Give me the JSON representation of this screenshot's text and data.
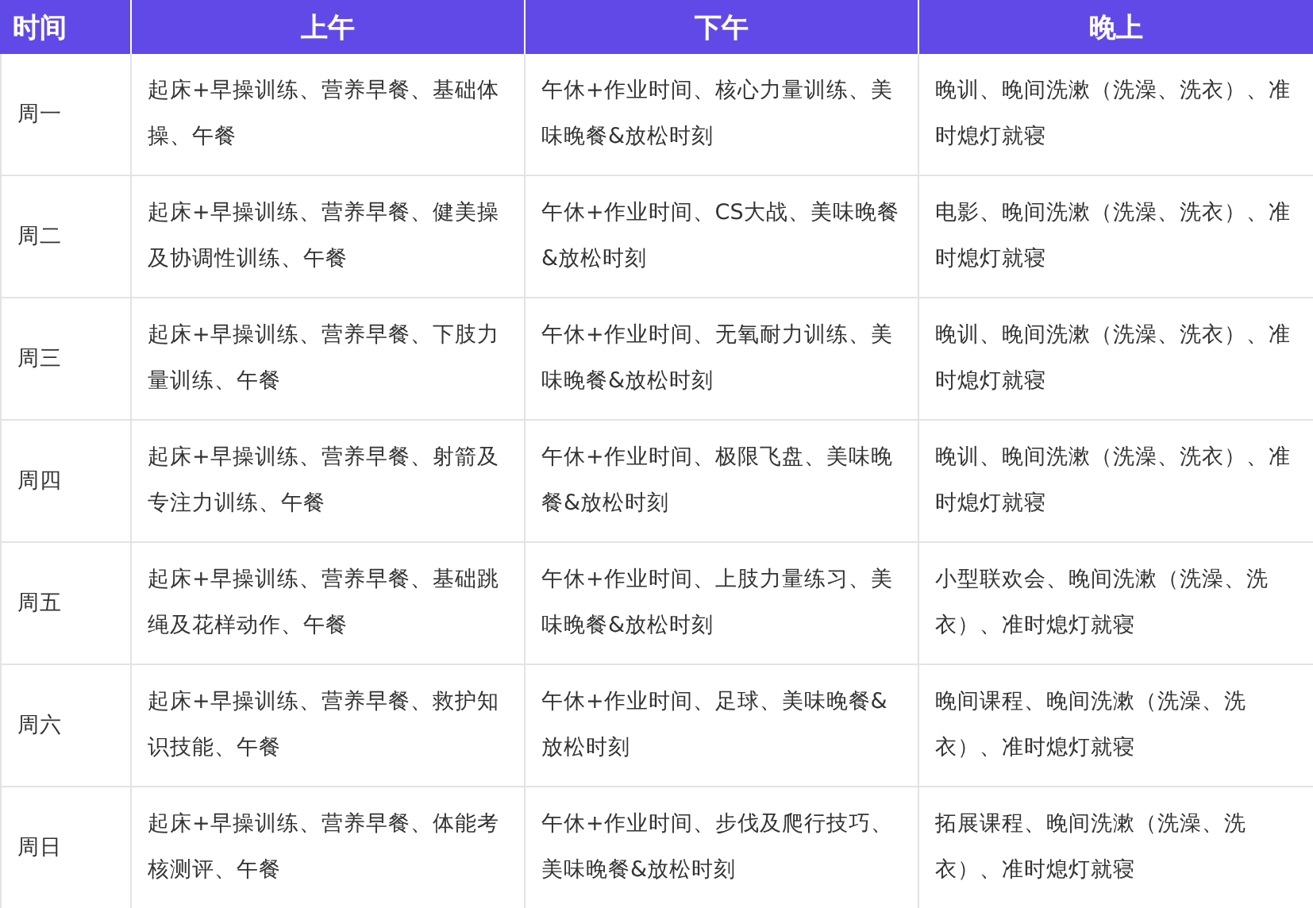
{
  "table": {
    "columns": [
      "时间",
      "上午",
      "下午",
      "晚上"
    ],
    "rows": [
      [
        "周一",
        "起床+早操训练、营养早餐、基础体操、午餐",
        "午休+作业时间、核心力量训练、美味晚餐&放松时刻",
        "晚训、晚间洗漱（洗澡、洗衣）、准时熄灯就寝"
      ],
      [
        "周二",
        "起床+早操训练、营养早餐、健美操及协调性训练、午餐",
        "午休+作业时间、CS大战、美味晚餐&放松时刻",
        "电影、晚间洗漱（洗澡、洗衣）、准时熄灯就寝"
      ],
      [
        "周三",
        "起床+早操训练、营养早餐、下肢力量训练、午餐",
        "午休+作业时间、无氧耐力训练、美味晚餐&放松时刻",
        "晚训、晚间洗漱（洗澡、洗衣）、准时熄灯就寝"
      ],
      [
        "周四",
        "起床+早操训练、营养早餐、射箭及专注力训练、午餐",
        "午休+作业时间、极限飞盘、美味晚餐&放松时刻",
        "晚训、晚间洗漱（洗澡、洗衣）、准时熄灯就寝"
      ],
      [
        "周五",
        "起床+早操训练、营养早餐、基础跳绳及花样动作、午餐",
        "午休+作业时间、上肢力量练习、美味晚餐&放松时刻",
        "小型联欢会、晚间洗漱（洗澡、洗衣）、准时熄灯就寝"
      ],
      [
        "周六",
        "起床+早操训练、营养早餐、救护知识技能、午餐",
        "午休+作业时间、足球、美味晚餐&放松时刻",
        "晚间课程、晚间洗漱（洗澡、洗衣）、准时熄灯就寝"
      ],
      [
        "周日",
        "起床+早操训练、营养早餐、体能考核测评、午餐",
        "午休+作业时间、步伐及爬行技巧、美味晚餐&放松时刻",
        "拓展课程、晚间洗漱（洗澡、洗衣）、准时熄灯就寝"
      ]
    ]
  }
}
